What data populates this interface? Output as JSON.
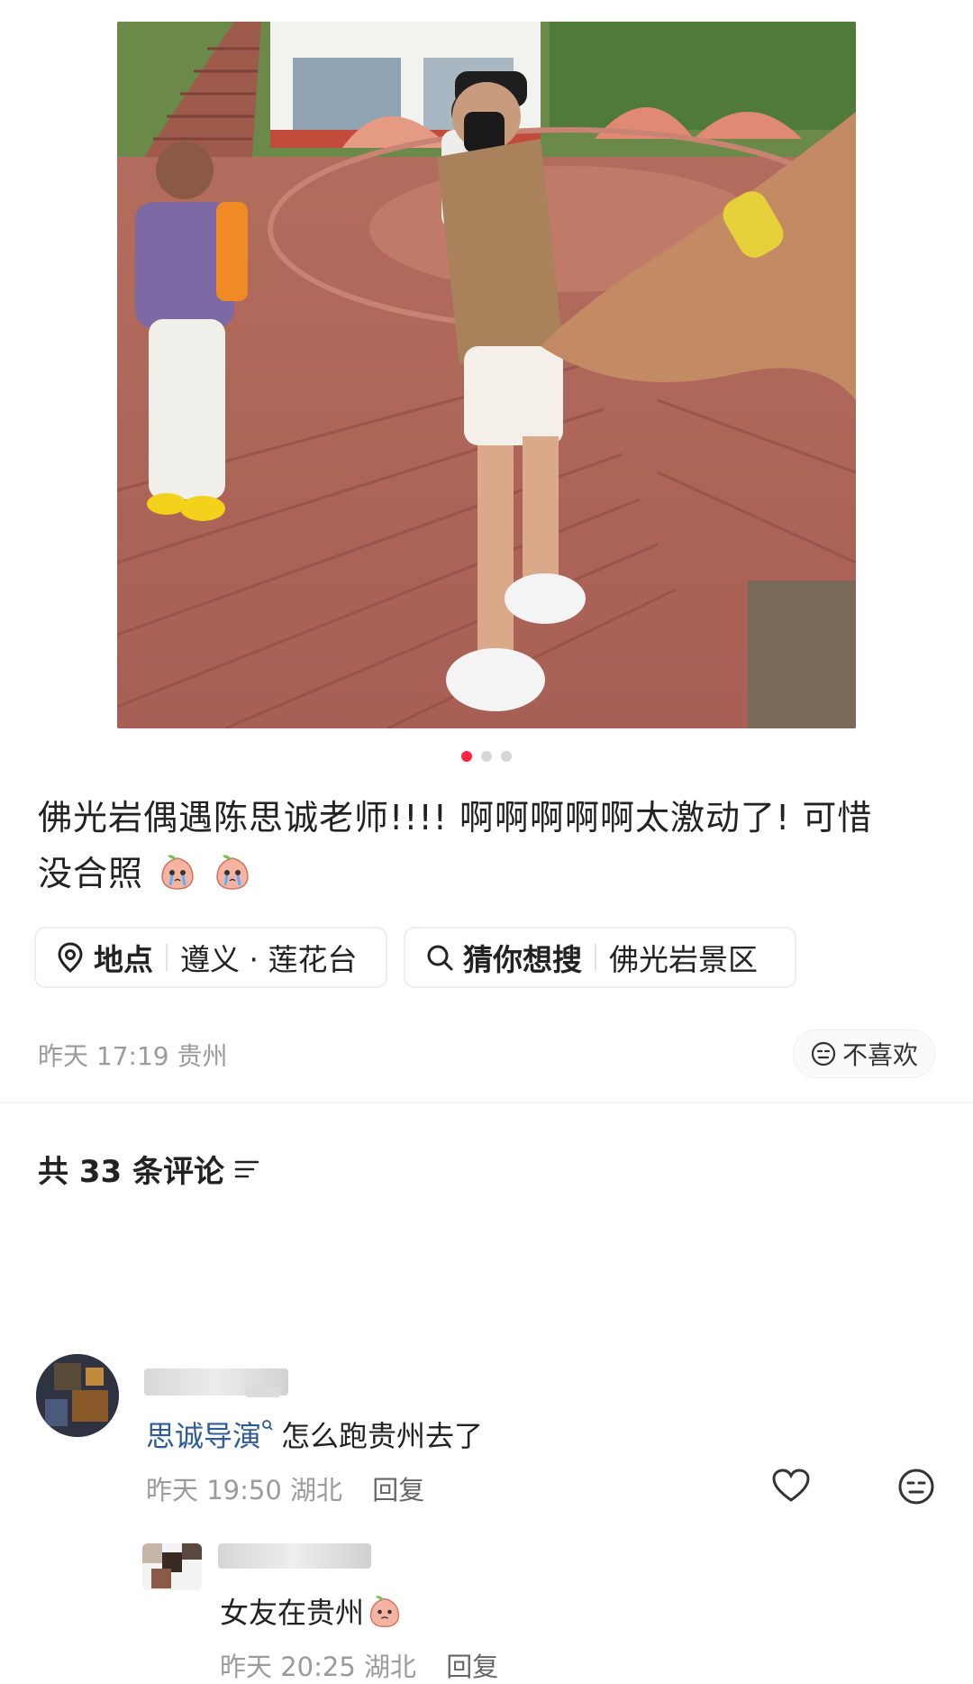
{
  "carousel": {
    "total": 3,
    "active": 1
  },
  "post": {
    "text_line1": "佛光岩偶遇陈思诚老师!!!! 啊啊啊啊啊太激动了! 可惜",
    "text_line2": "没合照",
    "emoji": "crying-peach-emoji"
  },
  "chips": {
    "location": {
      "label": "地点",
      "value": "遵义 · 莲花台",
      "icon": "location-pin-icon"
    },
    "search": {
      "label": "猜你想搜",
      "value": "佛光岩景区",
      "icon": "search-icon"
    }
  },
  "meta": {
    "time": "昨天 17:19",
    "place": "贵州"
  },
  "dislike": {
    "label": "不喜欢",
    "icon": "meh-face-icon"
  },
  "comments": {
    "count_text": "共 33 条评论",
    "items": [
      {
        "mention": "思诚导演",
        "text": "怎么跑贵州去了",
        "time": "昨天 19:50",
        "place": "湖北",
        "reply": "回复"
      },
      {
        "text": "女友在贵州",
        "time": "昨天 20:25",
        "place": "湖北",
        "reply": "回复"
      }
    ]
  },
  "colors": {
    "accent": "#ff2442",
    "mention": "#2e5b9a",
    "meta": "#9b9b9b"
  }
}
